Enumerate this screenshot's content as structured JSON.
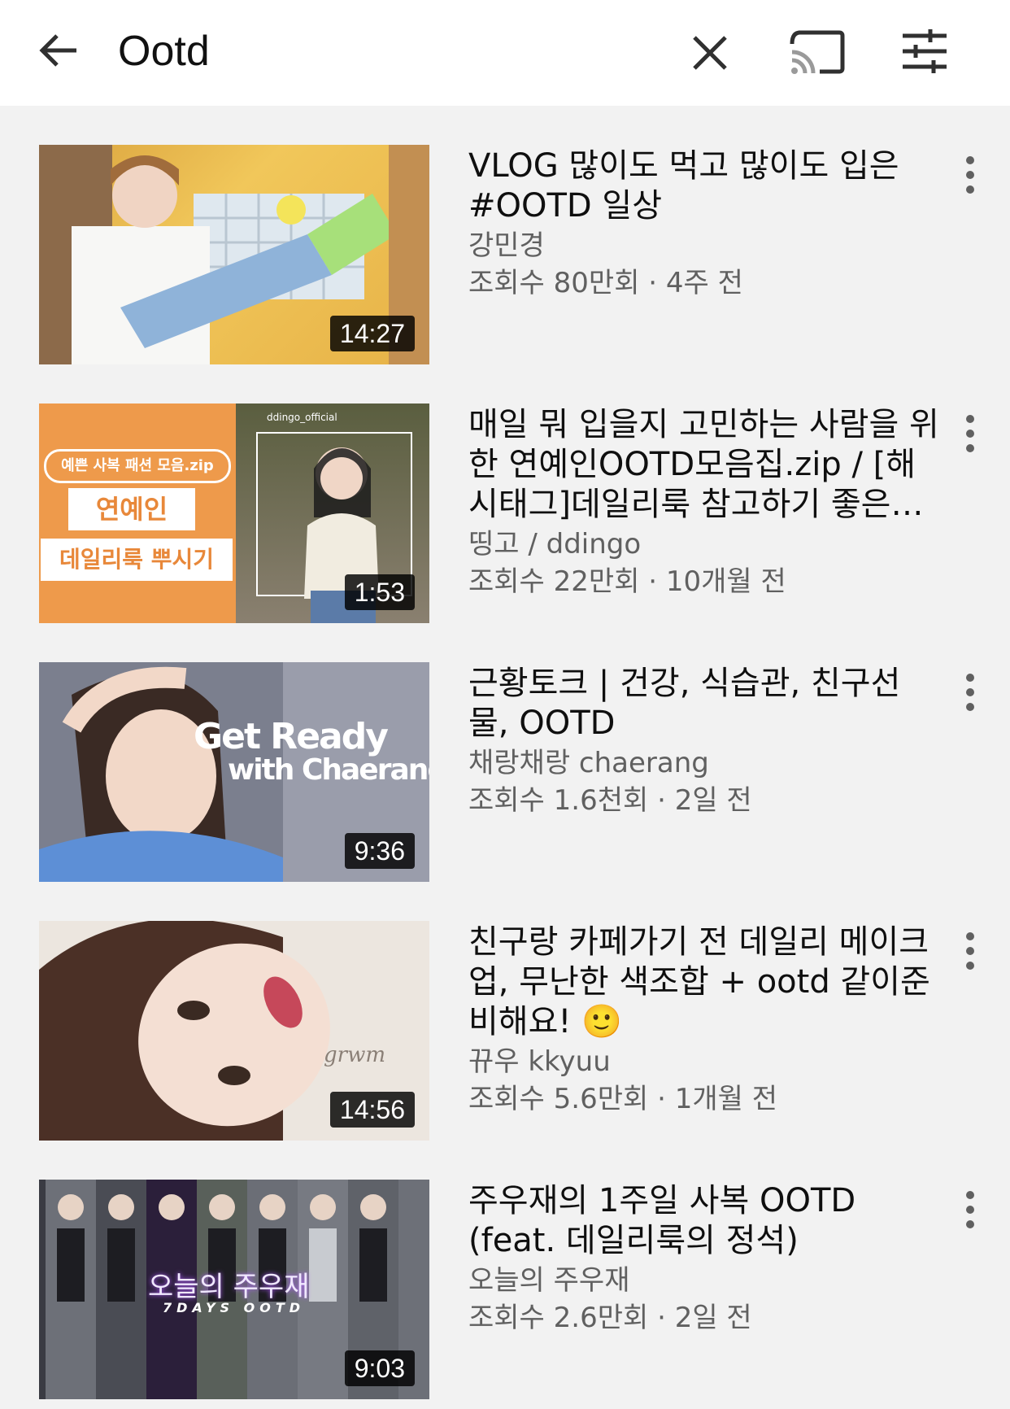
{
  "search": {
    "query": "Ootd"
  },
  "icons": {
    "back": "arrow-left-icon",
    "clear": "close-icon",
    "cast": "cast-icon",
    "filter": "filter-sliders-icon",
    "more": "more-vert-icon"
  },
  "colors": {
    "background": "#f2f2f2",
    "header": "#ffffff",
    "secondary_text": "#606060"
  },
  "videos": [
    {
      "title": "VLOG 많이도 먹고 많이도 입은 #OOTD 일상",
      "channel": "강민경",
      "stats": "조회수 80만회 · 4주 전",
      "duration": "14:27"
    },
    {
      "title": "매일 뭐 입을지 고민하는 사람을 위한 연예인OOTD모음집.zip / [해시태그]데일리룩 참고하기 좋은 연…",
      "channel": "띵고 / ddingo",
      "stats": "조회수 22만회 · 10개월 전",
      "duration": "1:53",
      "thumb_text": {
        "badge": "예쁜 사복 패션 모음.zip",
        "line1": "연예인",
        "line2": "데일리룩 뿌시기",
        "handle": "ddingo_official"
      }
    },
    {
      "title": "근황토크 | 건강, 식습관, 친구선물, OOTD",
      "channel": "채랑채랑 chaerang",
      "stats": "조회수 1.6천회 · 2일 전",
      "duration": "9:36",
      "thumb_text": {
        "line1": "Get Ready",
        "line2": "with Chaerang"
      }
    },
    {
      "title": "친구랑 카페가기 전 데일리 메이크업, 무난한 색조합 + ootd 같이준비해요! 🙂",
      "channel": "뀨우 kkyuu",
      "stats": "조회수 5.6만회 · 1개월 전",
      "duration": "14:56",
      "thumb_text": {
        "line1": "grwm"
      }
    },
    {
      "title": "주우재의 1주일 사복 OOTD (feat. 데일리룩의 정석)",
      "channel": "오늘의 주우재",
      "stats": "조회수 2.6만회 · 2일 전",
      "duration": "9:03",
      "thumb_text": {
        "line1": "오늘의 주우재",
        "line2": "7DAYS OOTD"
      }
    }
  ]
}
